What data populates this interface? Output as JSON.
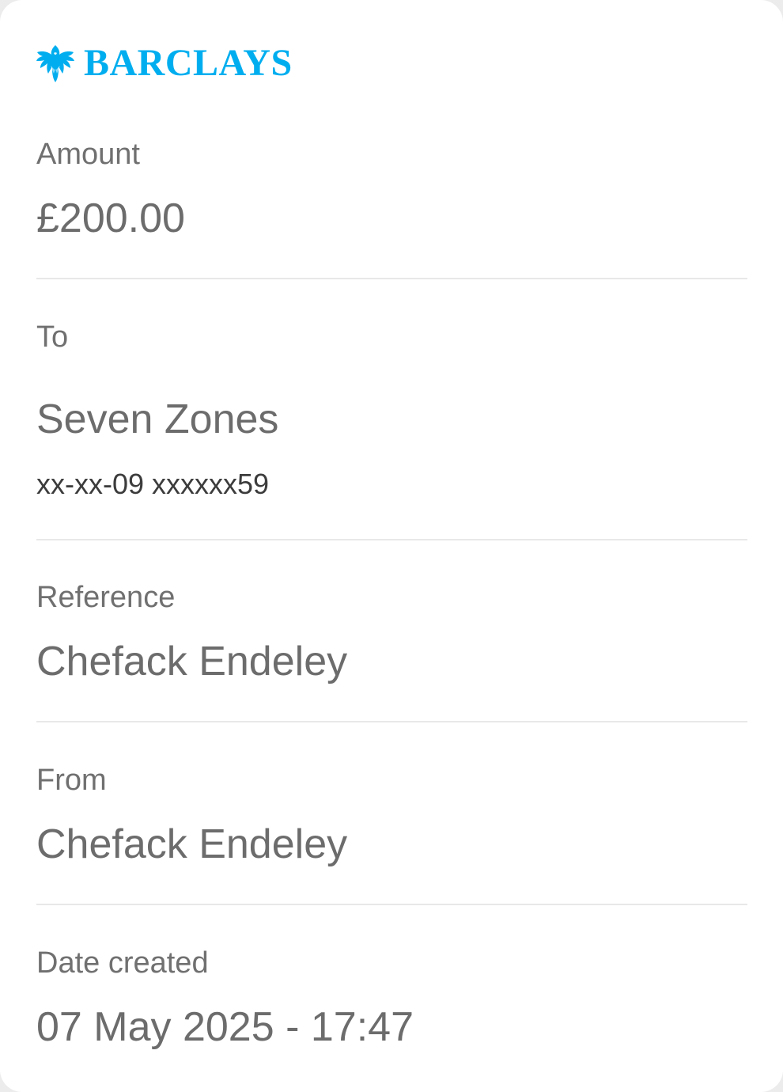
{
  "brand": {
    "logo_icon": "eagle-icon",
    "name": "BARCLAYS",
    "color": "#00AEEF"
  },
  "colors": {
    "label": "#707070",
    "value": "#6C6C6C",
    "divider": "#E8E8E8"
  },
  "amount": {
    "label": "Amount",
    "value": "£200.00"
  },
  "to": {
    "label": "To",
    "name": "Seven Zones",
    "account": "xx-xx-09 xxxxxx59"
  },
  "reference": {
    "label": "Reference",
    "value": "Chefack Endeley"
  },
  "from": {
    "label": "From",
    "value": "Chefack Endeley"
  },
  "date_created": {
    "label": "Date created",
    "value": "07 May 2025 - 17:47"
  }
}
